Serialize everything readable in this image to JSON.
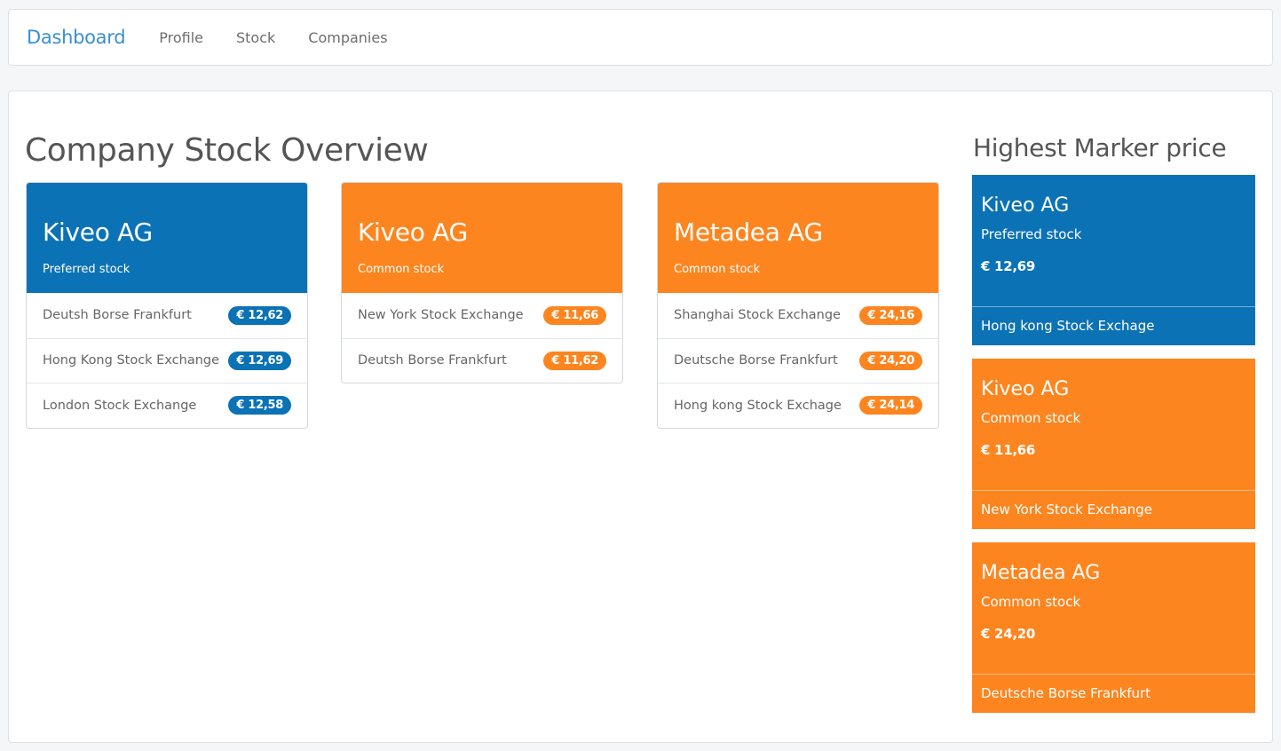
{
  "colors": {
    "blue": "#0b72b5",
    "orange": "#fd851f",
    "brand": "#3a8fd0"
  },
  "nav": {
    "brand": "Dashboard",
    "links": [
      "Profile",
      "Stock",
      "Companies"
    ]
  },
  "main": {
    "title": "Company Stock Overview",
    "cards": [
      {
        "name": "Kiveo AG",
        "type": "Preferred stock",
        "color": "blue",
        "rows": [
          {
            "exchange": "Deutsh Borse Frankfurt",
            "price": "€ 12,62"
          },
          {
            "exchange": "Hong Kong Stock Exchange",
            "price": "€ 12,69"
          },
          {
            "exchange": "London Stock Exchange",
            "price": "€ 12,58"
          }
        ]
      },
      {
        "name": "Kiveo AG",
        "type": "Common stock",
        "color": "orange",
        "rows": [
          {
            "exchange": "New York Stock Exchange",
            "price": "€ 11,66"
          },
          {
            "exchange": "Deutsh Borse Frankfurt",
            "price": "€ 11,62"
          }
        ]
      },
      {
        "name": "Metadea AG",
        "type": "Common stock",
        "color": "orange",
        "rows": [
          {
            "exchange": "Shanghai Stock Exchange",
            "price": "€ 24,16"
          },
          {
            "exchange": "Deutsche Borse Frankfurt",
            "price": "€ 24,20"
          },
          {
            "exchange": "Hong kong Stock Exchage",
            "price": "€ 24,14"
          }
        ]
      }
    ]
  },
  "sidebar": {
    "title": "Highest Marker price",
    "items": [
      {
        "name": "Kiveo AG",
        "type": "Preferred stock",
        "price": "€ 12,69",
        "exchange": "Hong kong Stock Exchage",
        "color": "blue"
      },
      {
        "name": "Kiveo AG",
        "type": "Common stock",
        "price": "€ 11,66",
        "exchange": "New York Stock Exchange",
        "color": "orange"
      },
      {
        "name": "Metadea AG",
        "type": "Common stock",
        "price": "€ 24,20",
        "exchange": "Deutsche Borse Frankfurt",
        "color": "orange"
      }
    ]
  }
}
